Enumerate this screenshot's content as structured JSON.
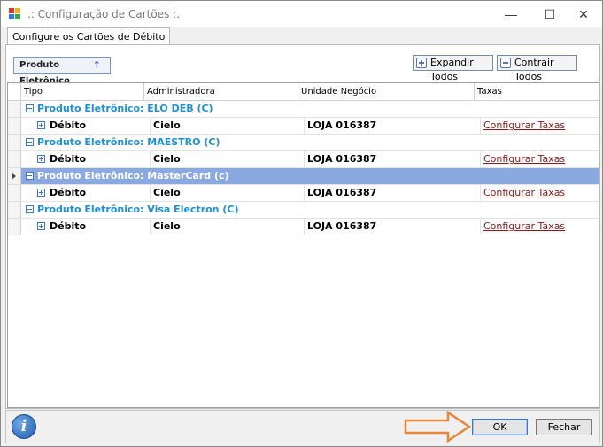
{
  "window": {
    "title": ".: Configuração de Cartões :.",
    "controls": {
      "minimize": "—",
      "maximize": "☐",
      "close": "✕"
    }
  },
  "tab": {
    "label": "Configure os Cartões de Débito"
  },
  "toolbar": {
    "group_button": "Produto Eletrônico",
    "group_arrow": "↑",
    "expand_all": "Expandir Todos",
    "collapse_all": "Contrair Todos"
  },
  "grid": {
    "columns": [
      "Tipo",
      "Administradora",
      "Unidade Negócio",
      "Taxas"
    ],
    "groups": [
      {
        "label": "Produto Eletrônico: ELO DEB (C)",
        "selected": false,
        "row": {
          "tipo": "Débito",
          "administradora": "Cielo",
          "unidade": "LOJA 016387",
          "taxas": "Configurar Taxas"
        }
      },
      {
        "label": "Produto Eletrônico: MAESTRO (C)",
        "selected": false,
        "row": {
          "tipo": "Débito",
          "administradora": "Cielo",
          "unidade": "LOJA 016387",
          "taxas": "Configurar Taxas"
        }
      },
      {
        "label": "Produto Eletrônico: MasterCard (c)",
        "selected": true,
        "row": {
          "tipo": "Débito",
          "administradora": "Cielo",
          "unidade": "LOJA 016387",
          "taxas": "Configurar Taxas"
        }
      },
      {
        "label": "Produto Eletrônico: Visa Electron (C)",
        "selected": false,
        "row": {
          "tipo": "Débito",
          "administradora": "Cielo",
          "unidade": "LOJA 016387",
          "taxas": "Configurar Taxas"
        }
      }
    ]
  },
  "footer": {
    "info_glyph": "i",
    "ok": "OK",
    "close": "Fechar"
  },
  "colors": {
    "group_text": "#1f8fd1",
    "selected_row": "#8aa9e0",
    "link": "#8b1a1a",
    "annotation_arrow": "#e8873a"
  }
}
